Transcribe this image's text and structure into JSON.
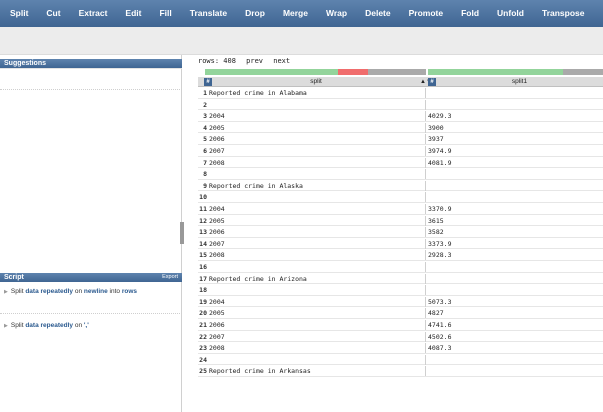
{
  "toolbar": {
    "tools": [
      "Split",
      "Cut",
      "Extract",
      "Edit",
      "Fill",
      "Translate",
      "Drop",
      "Merge",
      "Wrap",
      "Delete",
      "Promote",
      "Fold",
      "Unfold",
      "Transpose"
    ]
  },
  "sidebar": {
    "suggestions_title": "Suggestions",
    "script_title": "Script",
    "export_label": "Export",
    "steps": [
      {
        "pre": "Split ",
        "kw1": "data",
        "mid1": " ",
        "kw2": "repeatedly",
        "mid2": " on ",
        "kw3": "newline",
        "post": " into ",
        "kw4": "rows"
      },
      {
        "pre": "Split ",
        "kw1": "data",
        "mid1": " ",
        "kw2": "repeatedly",
        "mid2": " on ",
        "kw3": "','",
        "post": "",
        "kw4": ""
      }
    ]
  },
  "grid": {
    "rows_label": "rows: 408",
    "prev_label": "prev",
    "next_label": "next",
    "type_icon": "#",
    "columns": [
      "split",
      "split1"
    ],
    "rows": [
      {
        "n": "1",
        "a": "Reported crime in Alabama",
        "b": ""
      },
      {
        "n": "2",
        "a": "",
        "b": ""
      },
      {
        "n": "3",
        "a": "2004",
        "b": "4029.3"
      },
      {
        "n": "4",
        "a": "2005",
        "b": "3900"
      },
      {
        "n": "5",
        "a": "2006",
        "b": "3937"
      },
      {
        "n": "6",
        "a": "2007",
        "b": "3974.9"
      },
      {
        "n": "7",
        "a": "2008",
        "b": "4081.9"
      },
      {
        "n": "8",
        "a": "",
        "b": ""
      },
      {
        "n": "9",
        "a": "Reported crime in Alaska",
        "b": ""
      },
      {
        "n": "10",
        "a": "",
        "b": ""
      },
      {
        "n": "11",
        "a": "2004",
        "b": "3370.9"
      },
      {
        "n": "12",
        "a": "2005",
        "b": "3615"
      },
      {
        "n": "13",
        "a": "2006",
        "b": "3582"
      },
      {
        "n": "14",
        "a": "2007",
        "b": "3373.9"
      },
      {
        "n": "15",
        "a": "2008",
        "b": "2928.3"
      },
      {
        "n": "16",
        "a": "",
        "b": ""
      },
      {
        "n": "17",
        "a": "Reported crime in Arizona",
        "b": ""
      },
      {
        "n": "18",
        "a": "",
        "b": ""
      },
      {
        "n": "19",
        "a": "2004",
        "b": "5073.3"
      },
      {
        "n": "20",
        "a": "2005",
        "b": "4827"
      },
      {
        "n": "21",
        "a": "2006",
        "b": "4741.6"
      },
      {
        "n": "22",
        "a": "2007",
        "b": "4502.6"
      },
      {
        "n": "23",
        "a": "2008",
        "b": "4087.3"
      },
      {
        "n": "24",
        "a": "",
        "b": ""
      },
      {
        "n": "25",
        "a": "Reported crime in Arkansas",
        "b": ""
      }
    ]
  },
  "colors": {
    "toolbar": "#4a6f9c",
    "quality_valid": "#93d49b",
    "quality_error": "#f06d6d",
    "quality_empty": "#aaaaaa"
  }
}
